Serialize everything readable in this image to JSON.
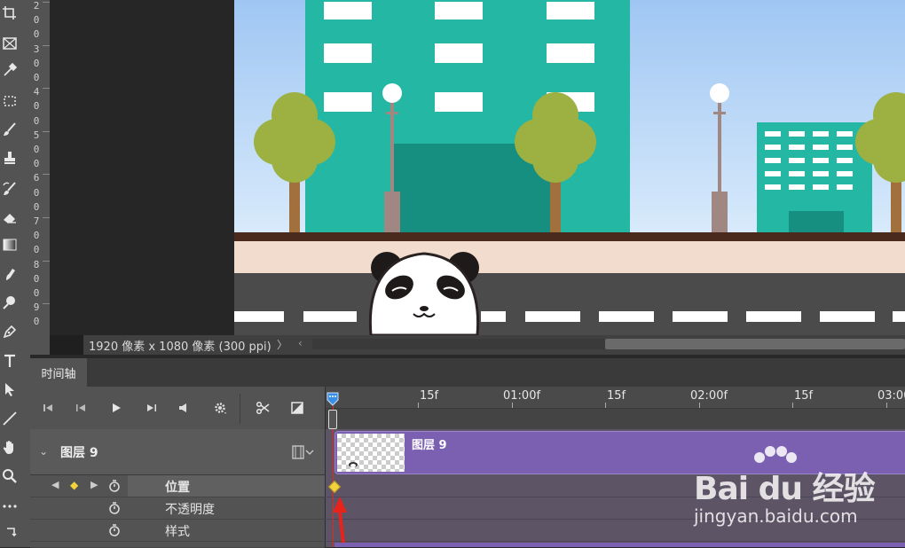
{
  "ruler": {
    "numbers": [
      "2",
      "0",
      "0",
      "3",
      "0",
      "0",
      "4",
      "0",
      "0",
      "5",
      "0",
      "0",
      "6",
      "0",
      "0",
      "7",
      "0",
      "0",
      "8",
      "0",
      "0",
      "9",
      "0"
    ]
  },
  "status": {
    "doc_info": "1920 像素 x 1080 像素 (300 ppi)",
    "arrow": "〉",
    "scroll_left": "‹"
  },
  "panel": {
    "tab_label": "时间轴"
  },
  "timeline": {
    "ticks": [
      {
        "label": "15f"
      },
      {
        "label": "01:00f"
      },
      {
        "label": "15f"
      },
      {
        "label": "02:00f"
      },
      {
        "label": "15f"
      },
      {
        "label": "03:00"
      }
    ]
  },
  "layer": {
    "name": "图层 9",
    "clip_label": "图层 9",
    "properties": [
      "位置",
      "不透明度",
      "样式"
    ]
  },
  "watermark": {
    "logo": "Bai du 经验",
    "url": "jingyan.baidu.com"
  },
  "colors": {
    "sky_top": "#9fc6f3",
    "building": "#24b7a4",
    "clip_purple": "#7b5fb0",
    "keyframe": "#f3d33a",
    "playhead": "#e0281e"
  },
  "icons": [
    "crop-icon",
    "frame-icon",
    "eyedropper-icon",
    "marquee-icon",
    "brush-icon",
    "stamp-icon",
    "history-brush-icon",
    "eraser-icon",
    "gradient-icon",
    "smudge-icon",
    "dodge-icon",
    "pen-icon",
    "type-icon",
    "path-select-icon",
    "line-icon",
    "hand-icon",
    "zoom-icon",
    "more-icon",
    "swap-icon"
  ]
}
